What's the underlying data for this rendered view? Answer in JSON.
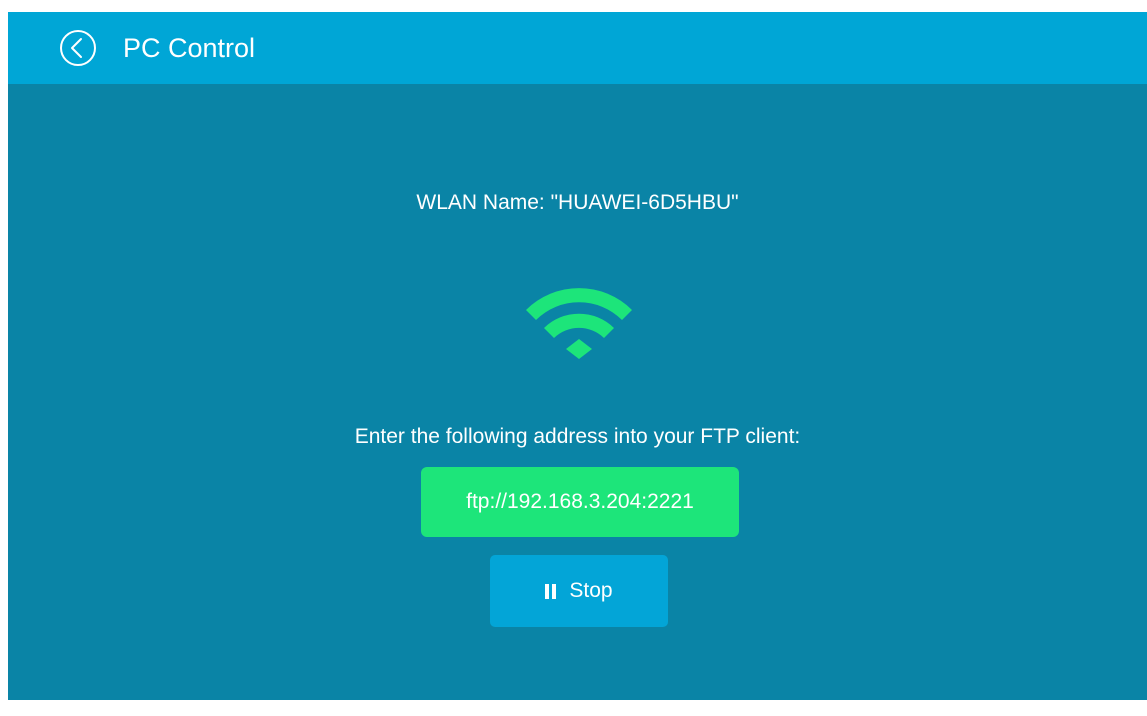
{
  "header": {
    "title": "PC Control",
    "back_icon": "back-arrow-circle-icon"
  },
  "wlan": {
    "text": "WLAN Name: \"HUAWEI-6D5HBU\""
  },
  "wifi_icon": "wifi-icon",
  "ftp": {
    "instruction": "Enter the following address into your FTP client:",
    "address": "ftp://192.168.3.204:2221"
  },
  "stop_button": {
    "icon": "pause-icon",
    "label": "Stop"
  },
  "colors": {
    "titlebar": "#00a6d6",
    "background": "#0a84a6",
    "accent_green": "#1de57a",
    "button_blue": "#03a5d7"
  }
}
